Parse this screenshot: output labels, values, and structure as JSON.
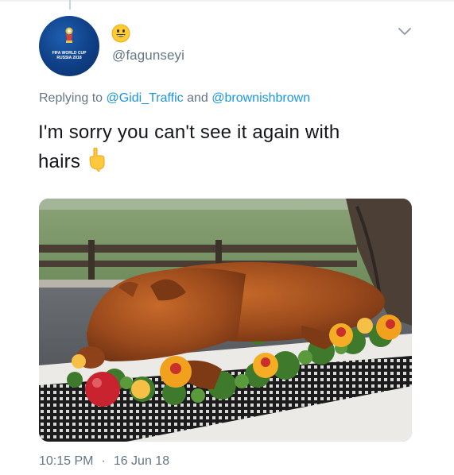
{
  "tweet": {
    "username": "@fagunseyi",
    "name_emoji_icon": "grinning-face-emoji",
    "avatar": {
      "icon": "world-cup-logo-icon",
      "line1": "FIFA WORLD CUP",
      "line2": "RUSSIA 2018"
    },
    "menu_icon": "chevron-down-icon",
    "reply": {
      "prefix": "Replying to ",
      "mention1": "@Gidi_Traffic",
      "connector": " and ",
      "mention2": "@brownishbrown"
    },
    "text_line1": "I'm sorry you can't see it again with",
    "text_line2": "hairs",
    "text_emoji_icon": "backhand-index-pointing-down-icon",
    "media": {
      "icon": "photo-roast-pig-icon"
    },
    "time": "10:15 PM",
    "separator": "·",
    "date": "16 Jun 18"
  },
  "colors": {
    "mention": "#1b95e0",
    "secondary_text": "#657786",
    "primary_text": "#14171a",
    "avatar_blue": "#0f3f86"
  }
}
